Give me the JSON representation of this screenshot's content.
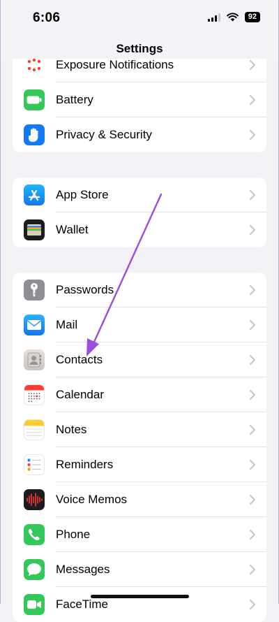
{
  "status": {
    "time": "6:06",
    "battery": "92"
  },
  "nav": {
    "title": "Settings"
  },
  "group0": [
    {
      "label": "Exposure Notifications",
      "icon": "exposure-icon"
    },
    {
      "label": "Battery",
      "icon": "battery-icon"
    },
    {
      "label": "Privacy & Security",
      "icon": "hand-icon"
    }
  ],
  "group1": [
    {
      "label": "App Store",
      "icon": "app-store-icon"
    },
    {
      "label": "Wallet",
      "icon": "wallet-icon"
    }
  ],
  "group2": [
    {
      "label": "Passwords",
      "icon": "key-icon"
    },
    {
      "label": "Mail",
      "icon": "mail-icon"
    },
    {
      "label": "Contacts",
      "icon": "contacts-icon"
    },
    {
      "label": "Calendar",
      "icon": "calendar-icon"
    },
    {
      "label": "Notes",
      "icon": "notes-icon"
    },
    {
      "label": "Reminders",
      "icon": "reminders-icon"
    },
    {
      "label": "Voice Memos",
      "icon": "voice-memos-icon"
    },
    {
      "label": "Phone",
      "icon": "phone-icon"
    },
    {
      "label": "Messages",
      "icon": "messages-icon"
    },
    {
      "label": "FaceTime",
      "icon": "facetime-icon"
    }
  ],
  "colors": {
    "annotation_arrow": "#9b4ddb",
    "battery_icon_bg": "#34c759",
    "privacy_icon_bg": "#1479f5",
    "app_store_icon_bg": "#1a8cf5",
    "mail_icon_bg": "#1b8ef6",
    "phone_icon_bg": "#34c759",
    "messages_icon_bg": "#34c759",
    "passwords_icon_bg": "#8e8e93"
  }
}
